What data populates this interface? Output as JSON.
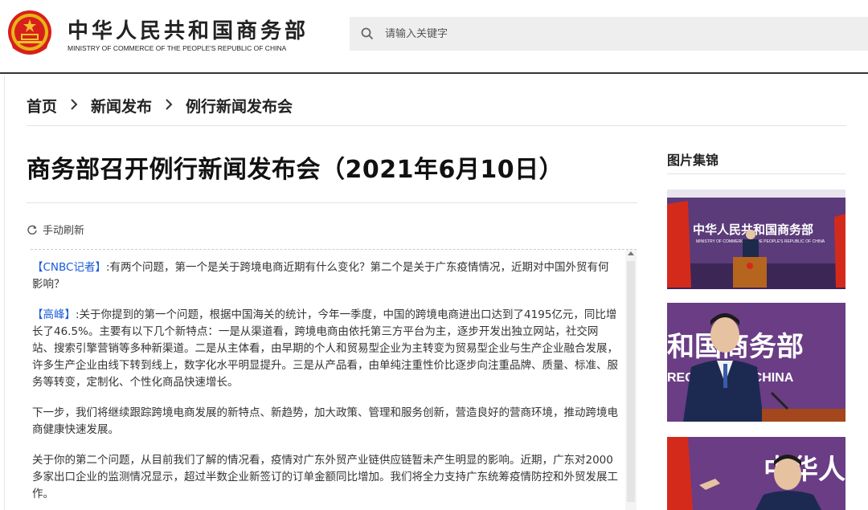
{
  "header": {
    "site_title": "中华人民共和国商务部",
    "site_subtitle": "MINISTRY OF COMMERCE OF THE PEOPLE'S REPUBLIC OF CHINA",
    "search_placeholder": "请输入关键字"
  },
  "breadcrumb": [
    "首页",
    "新闻发布",
    "例行新闻发布会"
  ],
  "article": {
    "title": "商务部召开例行新闻发布会（2021年6月10日）",
    "refresh_label": "手动刷新"
  },
  "live": {
    "q1_name": "【CNBC记者】",
    "q1_text": ":有两个问题，第一个是关于跨境电商近期有什么变化？第二个是关于广东疫情情况，近期对中国外贸有何影响？",
    "a1_name": "【高峰】",
    "a1_text": ":关于你提到的第一个问题，根据中国海关的统计，今年一季度，中国的跨境电商进出口达到了4195亿元，同比增长了46.5%。主要有以下几个新特点：一是从渠道看，跨境电商由依托第三方平台为主，逐步开发出独立网站，社交网站、搜索引擎营销等多种新渠道。二是从主体看，由早期的个人和贸易型企业为主转变为贸易型企业与生产企业融合发展，许多生产企业由线下转到线上，数字化水平明显提升。三是从产品看，由单纯注重性价比逐步向注重品牌、质量、标准、服务等转变，定制化、个性化商品快速增长。",
    "a2_text": "下一步，我们将继续跟踪跨境电商发展的新特点、新趋势，加大政策、管理和服务创新，营造良好的营商环境，推动跨境电商健康快速发展。",
    "a3_text": "关于你的第二个问题，从目前我们了解的情况看，疫情对广东外贸产业链供应链暂未产生明显的影响。近期，广东对2000多家出口企业的监测情况显示，超过半数企业新签订的订单金额同比增加。我们将全力支持广东统筹疫情防控和外贸发展工作。"
  },
  "sidebar": {
    "gallery_title": "图片集锦",
    "photo_backdrop_text": "中华人民共和国商务部",
    "photo_backdrop_sub": "MINISTRY OF COMMERCE OF THE PEOPLE'S REPUBLIC OF CHINA",
    "photo2_backdrop_top": "和国商务部",
    "photo2_backdrop_bottom": "REC     BLIC OF CHINA",
    "photo3_backdrop": "中华人"
  },
  "colors": {
    "link_blue": "#1a5bd8",
    "backdrop_purple": "#5d3d7c",
    "flag_red": "#d42a1c"
  }
}
